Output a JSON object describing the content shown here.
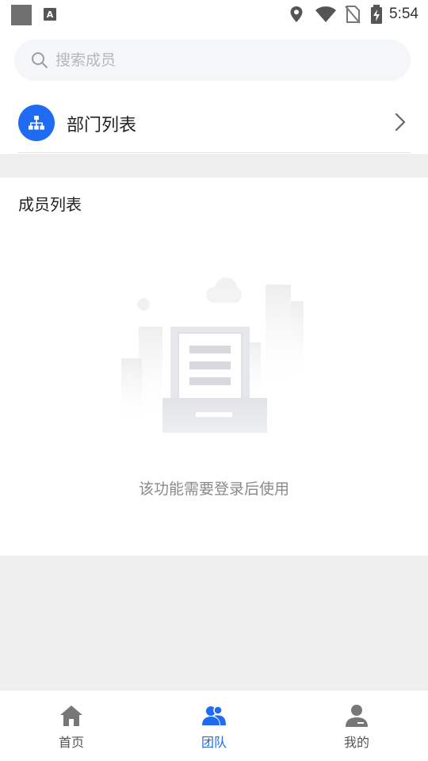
{
  "status_bar": {
    "time": "5:54",
    "icons": [
      "notification-square-icon",
      "text-a-icon",
      "location-icon",
      "wifi-icon",
      "no-sim-icon",
      "battery-charging-icon"
    ]
  },
  "search": {
    "placeholder": "搜索成员",
    "value": ""
  },
  "department": {
    "label": "部门列表",
    "icon": "org-chart-icon"
  },
  "members": {
    "title": "成员列表",
    "empty_message": "该功能需要登录后使用"
  },
  "bottom_nav": {
    "items": [
      {
        "label": "首页",
        "icon": "home-icon",
        "active": false
      },
      {
        "label": "团队",
        "icon": "team-icon",
        "active": true
      },
      {
        "label": "我的",
        "icon": "profile-icon",
        "active": false
      }
    ]
  },
  "colors": {
    "accent": "#1f6bf3",
    "background": "#efefef",
    "inactive_icon": "#777777"
  }
}
